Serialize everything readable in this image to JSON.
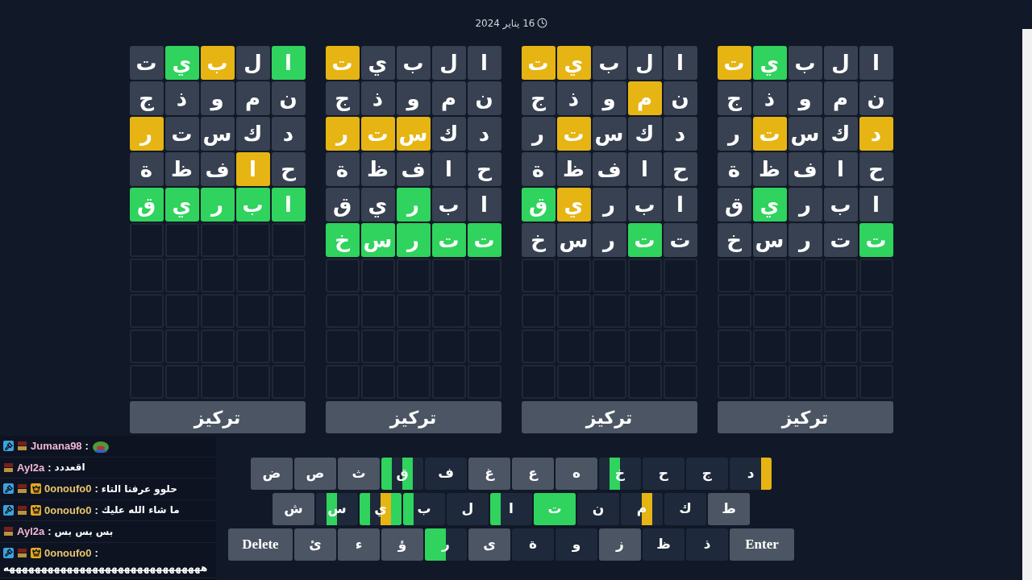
{
  "date": "16 يناير 2024",
  "boards": [
    {
      "focus": "تركيز",
      "rows": [
        {
          "cells": [
            {
              "letter": "ا",
              "kind": "absent"
            },
            {
              "letter": "ل",
              "kind": "absent"
            },
            {
              "letter": "ب",
              "kind": "absent"
            },
            {
              "letter": "ي",
              "kind": "correct"
            },
            {
              "letter": "ت",
              "kind": "present"
            }
          ]
        },
        {
          "cells": [
            {
              "letter": "ن",
              "kind": "absent"
            },
            {
              "letter": "م",
              "kind": "absent"
            },
            {
              "letter": "و",
              "kind": "absent"
            },
            {
              "letter": "ذ",
              "kind": "absent"
            },
            {
              "letter": "ج",
              "kind": "absent"
            }
          ]
        },
        {
          "cells": [
            {
              "letter": "د",
              "kind": "present"
            },
            {
              "letter": "ك",
              "kind": "absent"
            },
            {
              "letter": "س",
              "kind": "absent"
            },
            {
              "letter": "ت",
              "kind": "present"
            },
            {
              "letter": "ر",
              "kind": "absent"
            }
          ]
        },
        {
          "cells": [
            {
              "letter": "ح",
              "kind": "absent"
            },
            {
              "letter": "ا",
              "kind": "absent"
            },
            {
              "letter": "ف",
              "kind": "absent"
            },
            {
              "letter": "ظ",
              "kind": "absent"
            },
            {
              "letter": "ة",
              "kind": "absent"
            }
          ]
        },
        {
          "cells": [
            {
              "letter": "ا",
              "kind": "absent"
            },
            {
              "letter": "ب",
              "kind": "absent"
            },
            {
              "letter": "ر",
              "kind": "absent"
            },
            {
              "letter": "ي",
              "kind": "correct"
            },
            {
              "letter": "ق",
              "kind": "absent"
            }
          ]
        },
        {
          "cells": [
            {
              "letter": "ت",
              "kind": "correct"
            },
            {
              "letter": "ت",
              "kind": "absent"
            },
            {
              "letter": "ر",
              "kind": "absent"
            },
            {
              "letter": "س",
              "kind": "absent"
            },
            {
              "letter": "خ",
              "kind": "absent"
            }
          ]
        },
        {
          "cells": [
            {
              "kind": "empty"
            },
            {
              "kind": "empty"
            },
            {
              "kind": "empty"
            },
            {
              "kind": "empty"
            },
            {
              "kind": "empty"
            }
          ]
        },
        {
          "cells": [
            {
              "kind": "empty"
            },
            {
              "kind": "empty"
            },
            {
              "kind": "empty"
            },
            {
              "kind": "empty"
            },
            {
              "kind": "empty"
            }
          ]
        },
        {
          "cells": [
            {
              "kind": "empty"
            },
            {
              "kind": "empty"
            },
            {
              "kind": "empty"
            },
            {
              "kind": "empty"
            },
            {
              "kind": "empty"
            }
          ]
        },
        {
          "cells": [
            {
              "kind": "empty"
            },
            {
              "kind": "empty"
            },
            {
              "kind": "empty"
            },
            {
              "kind": "empty"
            },
            {
              "kind": "empty"
            }
          ]
        }
      ]
    },
    {
      "focus": "تركيز",
      "rows": [
        {
          "cells": [
            {
              "letter": "ا",
              "kind": "absent"
            },
            {
              "letter": "ل",
              "kind": "absent"
            },
            {
              "letter": "ب",
              "kind": "absent"
            },
            {
              "letter": "ي",
              "kind": "present"
            },
            {
              "letter": "ت",
              "kind": "present"
            }
          ]
        },
        {
          "cells": [
            {
              "letter": "ن",
              "kind": "absent"
            },
            {
              "letter": "م",
              "kind": "present"
            },
            {
              "letter": "و",
              "kind": "absent"
            },
            {
              "letter": "ذ",
              "kind": "absent"
            },
            {
              "letter": "ج",
              "kind": "absent"
            }
          ]
        },
        {
          "cells": [
            {
              "letter": "د",
              "kind": "absent"
            },
            {
              "letter": "ك",
              "kind": "absent"
            },
            {
              "letter": "س",
              "kind": "absent"
            },
            {
              "letter": "ت",
              "kind": "present"
            },
            {
              "letter": "ر",
              "kind": "absent"
            }
          ]
        },
        {
          "cells": [
            {
              "letter": "ح",
              "kind": "absent"
            },
            {
              "letter": "ا",
              "kind": "absent"
            },
            {
              "letter": "ف",
              "kind": "absent"
            },
            {
              "letter": "ظ",
              "kind": "absent"
            },
            {
              "letter": "ة",
              "kind": "absent"
            }
          ]
        },
        {
          "cells": [
            {
              "letter": "ا",
              "kind": "absent"
            },
            {
              "letter": "ب",
              "kind": "absent"
            },
            {
              "letter": "ر",
              "kind": "absent"
            },
            {
              "letter": "ي",
              "kind": "present"
            },
            {
              "letter": "ق",
              "kind": "correct"
            }
          ]
        },
        {
          "cells": [
            {
              "letter": "ت",
              "kind": "absent"
            },
            {
              "letter": "ت",
              "kind": "correct"
            },
            {
              "letter": "ر",
              "kind": "absent"
            },
            {
              "letter": "س",
              "kind": "absent"
            },
            {
              "letter": "خ",
              "kind": "absent"
            }
          ]
        },
        {
          "cells": [
            {
              "kind": "empty"
            },
            {
              "kind": "empty"
            },
            {
              "kind": "empty"
            },
            {
              "kind": "empty"
            },
            {
              "kind": "empty"
            }
          ]
        },
        {
          "cells": [
            {
              "kind": "empty"
            },
            {
              "kind": "empty"
            },
            {
              "kind": "empty"
            },
            {
              "kind": "empty"
            },
            {
              "kind": "empty"
            }
          ]
        },
        {
          "cells": [
            {
              "kind": "empty"
            },
            {
              "kind": "empty"
            },
            {
              "kind": "empty"
            },
            {
              "kind": "empty"
            },
            {
              "kind": "empty"
            }
          ]
        },
        {
          "cells": [
            {
              "kind": "empty"
            },
            {
              "kind": "empty"
            },
            {
              "kind": "empty"
            },
            {
              "kind": "empty"
            },
            {
              "kind": "empty"
            }
          ]
        }
      ]
    },
    {
      "focus": "تركيز",
      "rows": [
        {
          "cells": [
            {
              "letter": "ا",
              "kind": "absent"
            },
            {
              "letter": "ل",
              "kind": "absent"
            },
            {
              "letter": "ب",
              "kind": "absent"
            },
            {
              "letter": "ي",
              "kind": "absent"
            },
            {
              "letter": "ت",
              "kind": "present"
            }
          ]
        },
        {
          "cells": [
            {
              "letter": "ن",
              "kind": "absent"
            },
            {
              "letter": "م",
              "kind": "absent"
            },
            {
              "letter": "و",
              "kind": "absent"
            },
            {
              "letter": "ذ",
              "kind": "absent"
            },
            {
              "letter": "ج",
              "kind": "absent"
            }
          ]
        },
        {
          "cells": [
            {
              "letter": "د",
              "kind": "absent"
            },
            {
              "letter": "ك",
              "kind": "absent"
            },
            {
              "letter": "س",
              "kind": "present"
            },
            {
              "letter": "ت",
              "kind": "present"
            },
            {
              "letter": "ر",
              "kind": "present"
            }
          ]
        },
        {
          "cells": [
            {
              "letter": "ح",
              "kind": "absent"
            },
            {
              "letter": "ا",
              "kind": "absent"
            },
            {
              "letter": "ف",
              "kind": "absent"
            },
            {
              "letter": "ظ",
              "kind": "absent"
            },
            {
              "letter": "ة",
              "kind": "absent"
            }
          ]
        },
        {
          "cells": [
            {
              "letter": "ا",
              "kind": "absent"
            },
            {
              "letter": "ب",
              "kind": "absent"
            },
            {
              "letter": "ر",
              "kind": "correct"
            },
            {
              "letter": "ي",
              "kind": "absent"
            },
            {
              "letter": "ق",
              "kind": "absent"
            }
          ]
        },
        {
          "cells": [
            {
              "letter": "ت",
              "kind": "correct"
            },
            {
              "letter": "ت",
              "kind": "correct"
            },
            {
              "letter": "ر",
              "kind": "correct"
            },
            {
              "letter": "س",
              "kind": "correct"
            },
            {
              "letter": "خ",
              "kind": "correct"
            }
          ]
        },
        {
          "cells": [
            {
              "kind": "empty"
            },
            {
              "kind": "empty"
            },
            {
              "kind": "empty"
            },
            {
              "kind": "empty"
            },
            {
              "kind": "empty"
            }
          ]
        },
        {
          "cells": [
            {
              "kind": "empty"
            },
            {
              "kind": "empty"
            },
            {
              "kind": "empty"
            },
            {
              "kind": "empty"
            },
            {
              "kind": "empty"
            }
          ]
        },
        {
          "cells": [
            {
              "kind": "empty"
            },
            {
              "kind": "empty"
            },
            {
              "kind": "empty"
            },
            {
              "kind": "empty"
            },
            {
              "kind": "empty"
            }
          ]
        },
        {
          "cells": [
            {
              "kind": "empty"
            },
            {
              "kind": "empty"
            },
            {
              "kind": "empty"
            },
            {
              "kind": "empty"
            },
            {
              "kind": "empty"
            }
          ]
        }
      ]
    },
    {
      "focus": "تركيز",
      "rows": [
        {
          "cells": [
            {
              "letter": "ا",
              "kind": "correct"
            },
            {
              "letter": "ل",
              "kind": "absent"
            },
            {
              "letter": "ب",
              "kind": "present"
            },
            {
              "letter": "ي",
              "kind": "correct"
            },
            {
              "letter": "ت",
              "kind": "absent"
            }
          ]
        },
        {
          "cells": [
            {
              "letter": "ن",
              "kind": "absent"
            },
            {
              "letter": "م",
              "kind": "absent"
            },
            {
              "letter": "و",
              "kind": "absent"
            },
            {
              "letter": "ذ",
              "kind": "absent"
            },
            {
              "letter": "ج",
              "kind": "absent"
            }
          ]
        },
        {
          "cells": [
            {
              "letter": "د",
              "kind": "absent"
            },
            {
              "letter": "ك",
              "kind": "absent"
            },
            {
              "letter": "س",
              "kind": "absent"
            },
            {
              "letter": "ت",
              "kind": "absent"
            },
            {
              "letter": "ر",
              "kind": "present"
            }
          ]
        },
        {
          "cells": [
            {
              "letter": "ح",
              "kind": "absent"
            },
            {
              "letter": "ا",
              "kind": "present"
            },
            {
              "letter": "ف",
              "kind": "absent"
            },
            {
              "letter": "ظ",
              "kind": "absent"
            },
            {
              "letter": "ة",
              "kind": "absent"
            }
          ]
        },
        {
          "cells": [
            {
              "letter": "ا",
              "kind": "correct"
            },
            {
              "letter": "ب",
              "kind": "correct"
            },
            {
              "letter": "ر",
              "kind": "correct"
            },
            {
              "letter": "ي",
              "kind": "correct"
            },
            {
              "letter": "ق",
              "kind": "correct"
            }
          ]
        },
        {
          "cells": [
            {
              "kind": "empty"
            },
            {
              "kind": "empty"
            },
            {
              "kind": "empty"
            },
            {
              "kind": "empty"
            },
            {
              "kind": "empty"
            }
          ]
        },
        {
          "cells": [
            {
              "kind": "empty"
            },
            {
              "kind": "empty"
            },
            {
              "kind": "empty"
            },
            {
              "kind": "empty"
            },
            {
              "kind": "empty"
            }
          ]
        },
        {
          "cells": [
            {
              "kind": "empty"
            },
            {
              "kind": "empty"
            },
            {
              "kind": "empty"
            },
            {
              "kind": "empty"
            },
            {
              "kind": "empty"
            }
          ]
        },
        {
          "cells": [
            {
              "kind": "empty"
            },
            {
              "kind": "empty"
            },
            {
              "kind": "empty"
            },
            {
              "kind": "empty"
            },
            {
              "kind": "empty"
            }
          ]
        },
        {
          "cells": [
            {
              "kind": "empty"
            },
            {
              "kind": "empty"
            },
            {
              "kind": "empty"
            },
            {
              "kind": "empty"
            },
            {
              "kind": "empty"
            }
          ]
        }
      ]
    }
  ],
  "keyboard": [
    {
      "keys": [
        {
          "label": "د",
          "kind": "letter",
          "used": true,
          "segments": [
            {
              "kind": "present"
            },
            {
              "kind": "none"
            },
            {
              "kind": "none"
            },
            {
              "kind": "none"
            }
          ]
        },
        {
          "label": "ج",
          "kind": "letter",
          "used": true
        },
        {
          "label": "ح",
          "kind": "letter",
          "used": true
        },
        {
          "label": "خ",
          "kind": "letter",
          "used": true,
          "segments": [
            {
              "kind": "none"
            },
            {
              "kind": "none"
            },
            {
              "kind": "correct"
            },
            {
              "kind": "none"
            }
          ]
        },
        {
          "label": "ه",
          "kind": "letter",
          "used": false
        },
        {
          "label": "ع",
          "kind": "letter",
          "used": false
        },
        {
          "label": "غ",
          "kind": "letter",
          "used": false
        },
        {
          "label": "ف",
          "kind": "letter",
          "used": true
        },
        {
          "label": "ق",
          "kind": "letter",
          "used": true,
          "segments": [
            {
              "kind": "none"
            },
            {
              "kind": "correct"
            },
            {
              "kind": "none"
            },
            {
              "kind": "correct"
            }
          ]
        },
        {
          "label": "ث",
          "kind": "letter",
          "used": false
        },
        {
          "label": "ص",
          "kind": "letter",
          "used": false
        },
        {
          "label": "ض",
          "kind": "letter",
          "used": false
        }
      ]
    },
    {
      "keys": [
        {
          "label": "ط",
          "kind": "letter",
          "used": false
        },
        {
          "label": "ك",
          "kind": "letter",
          "used": true
        },
        {
          "label": "م",
          "kind": "letter",
          "used": true,
          "segments": [
            {
              "kind": "none"
            },
            {
              "kind": "present"
            },
            {
              "kind": "none"
            },
            {
              "kind": "none"
            }
          ]
        },
        {
          "label": "ن",
          "kind": "letter",
          "used": true
        },
        {
          "label": "ت",
          "kind": "letter",
          "segments": [
            {
              "kind": "correct"
            },
            {
              "kind": "correct"
            },
            {
              "kind": "correct"
            },
            {
              "kind": "correct"
            }
          ]
        },
        {
          "label": "ا",
          "kind": "letter",
          "used": true,
          "segments": [
            {
              "kind": "none"
            },
            {
              "kind": "none"
            },
            {
              "kind": "none"
            },
            {
              "kind": "correct"
            }
          ]
        },
        {
          "label": "ل",
          "kind": "letter",
          "used": true
        },
        {
          "label": "ب",
          "kind": "letter",
          "used": true,
          "segments": [
            {
              "kind": "none"
            },
            {
              "kind": "none"
            },
            {
              "kind": "none"
            },
            {
              "kind": "correct"
            }
          ]
        },
        {
          "label": "ي",
          "kind": "letter",
          "used": true,
          "segments": [
            {
              "kind": "correct"
            },
            {
              "kind": "present"
            },
            {
              "kind": "none"
            },
            {
              "kind": "correct"
            }
          ]
        },
        {
          "label": "س",
          "kind": "letter",
          "used": true,
          "segments": [
            {
              "kind": "none"
            },
            {
              "kind": "none"
            },
            {
              "kind": "correct"
            },
            {
              "kind": "none"
            }
          ]
        },
        {
          "label": "ش",
          "kind": "letter",
          "used": false
        }
      ]
    },
    {
      "keys": [
        {
          "label": "Enter",
          "kind": "action",
          "used": false
        },
        {
          "label": "ذ",
          "kind": "letter",
          "used": true
        },
        {
          "label": "ظ",
          "kind": "letter",
          "used": true
        },
        {
          "label": "ز",
          "kind": "letter",
          "used": false
        },
        {
          "label": "و",
          "kind": "letter",
          "used": true
        },
        {
          "label": "ة",
          "kind": "letter",
          "used": true
        },
        {
          "label": "ى",
          "kind": "letter",
          "used": false
        },
        {
          "label": "ر",
          "kind": "letter",
          "used": true,
          "segments": [
            {
              "kind": "none"
            },
            {
              "kind": "none"
            },
            {
              "kind": "correct"
            },
            {
              "kind": "correct"
            }
          ]
        },
        {
          "label": "ؤ",
          "kind": "letter",
          "used": false
        },
        {
          "label": "ء",
          "kind": "letter",
          "used": false
        },
        {
          "label": "ئ",
          "kind": "letter",
          "used": false
        },
        {
          "label": "Delete",
          "kind": "action",
          "used": false
        }
      ]
    }
  ],
  "chat": [
    {
      "user": "Jumana98",
      "color": "#f2b8d4",
      "badges": [
        {
          "kind": "mod"
        },
        {
          "kind": "gex"
        }
      ],
      "sep": ":",
      "kind": "emote"
    },
    {
      "user": "Ayl2a",
      "color": "#f2b8d4",
      "badges": [
        {
          "kind": "gex"
        }
      ],
      "sep": ":",
      "kind": "text",
      "text": "اقعددد"
    },
    {
      "user": "0onoufo0",
      "color": "#e8c56c",
      "badges": [
        {
          "kind": "mod"
        },
        {
          "kind": "gex"
        },
        {
          "kind": "crown"
        }
      ],
      "sep": ":",
      "kind": "text",
      "text": "حلوو عرفنا التاء"
    },
    {
      "user": "0onoufo0",
      "color": "#e8c56c",
      "badges": [
        {
          "kind": "mod"
        },
        {
          "kind": "gex"
        },
        {
          "kind": "crown"
        }
      ],
      "sep": ":",
      "kind": "text",
      "text": "ما شاء الله عليك"
    },
    {
      "user": "Ayl2a",
      "color": "#f2b8d4",
      "badges": [
        {
          "kind": "gex"
        }
      ],
      "sep": ":",
      "kind": "text",
      "text": "بس بس بس"
    },
    {
      "user": "0onoufo0",
      "color": "#e8c56c",
      "badges": [
        {
          "kind": "mod"
        },
        {
          "kind": "gex"
        },
        {
          "kind": "crown"
        }
      ],
      "sep": ":",
      "kind": "text",
      "text": "هههههههههههههههههههههههههههههههه"
    }
  ]
}
